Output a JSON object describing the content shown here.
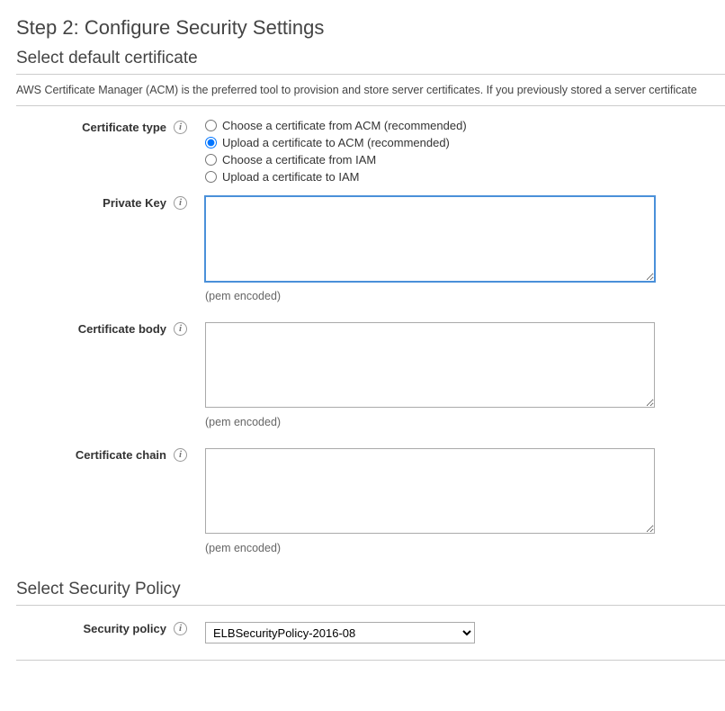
{
  "page": {
    "step_title": "Step 2: Configure Security Settings",
    "section1_title": "Select default certificate",
    "intro": "AWS Certificate Manager (ACM) is the preferred tool to provision and store server certificates. If you previously stored a server certificate",
    "section2_title": "Select Security Policy"
  },
  "labels": {
    "certificate_type": "Certificate type",
    "private_key": "Private Key",
    "certificate_body": "Certificate body",
    "certificate_chain": "Certificate chain",
    "security_policy": "Security policy"
  },
  "cert_type_options": {
    "opt0": "Choose a certificate from ACM (recommended)",
    "opt1": "Upload a certificate to ACM (recommended)",
    "opt2": "Choose a certificate from IAM",
    "opt3": "Upload a certificate to IAM"
  },
  "hints": {
    "pem": "(pem encoded)"
  },
  "values": {
    "private_key": "",
    "certificate_body": "",
    "certificate_chain": "",
    "security_policy": "ELBSecurityPolicy-2016-08"
  },
  "icons": {
    "info": "i"
  }
}
